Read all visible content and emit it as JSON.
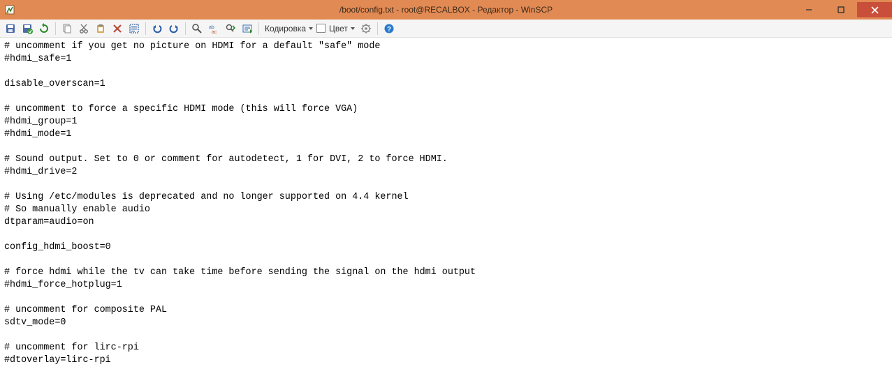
{
  "window": {
    "title": "/boot/config.txt - root@RECALBOX - Редактор - WinSCP"
  },
  "toolbar": {
    "encoding_label": "Кодировка",
    "color_label": "Цвет"
  },
  "editor_content": "# uncomment if you get no picture on HDMI for a default \"safe\" mode\n#hdmi_safe=1\n\ndisable_overscan=1\n\n# uncomment to force a specific HDMI mode (this will force VGA)\n#hdmi_group=1\n#hdmi_mode=1\n\n# Sound output. Set to 0 or comment for autodetect, 1 for DVI, 2 to force HDMI.\n#hdmi_drive=2\n\n# Using /etc/modules is deprecated and no longer supported on 4.4 kernel\n# So manually enable audio\ndtparam=audio=on\n\nconfig_hdmi_boost=0\n\n# force hdmi while the tv can take time before sending the signal on the hdmi output\n#hdmi_force_hotplug=1\n\n# uncomment for composite PAL\nsdtv_mode=0\n\n# uncomment for lirc-rpi\n#dtoverlay=lirc-rpi"
}
